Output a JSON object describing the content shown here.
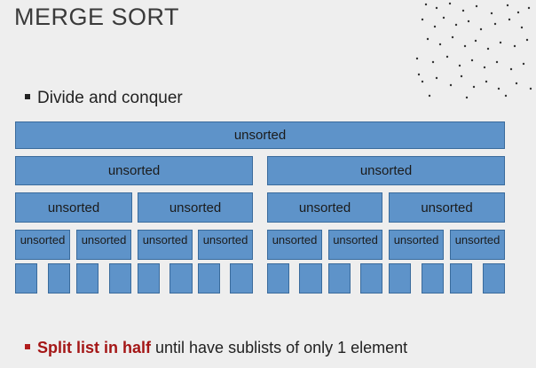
{
  "title": "MERGE SORT",
  "bullet1": "Divide and conquer",
  "diagram": {
    "level0": [
      "unsorted"
    ],
    "level1": [
      "unsorted",
      "unsorted"
    ],
    "level2": [
      "unsorted",
      "unsorted",
      "unsorted",
      "unsorted"
    ],
    "level3": [
      "unsorted",
      "unsorted",
      "unsorted",
      "unsorted",
      "unsorted",
      "unsorted",
      "unsorted",
      "unsorted"
    ],
    "level4_count": 16
  },
  "bottom": {
    "highlight": "Split list in half",
    "rest": " until have sublists of only 1 element"
  },
  "colors": {
    "box_fill": "#5e93c9",
    "box_border": "#3a6b9c",
    "highlight": "#a41616",
    "background": "#eeeeee"
  }
}
